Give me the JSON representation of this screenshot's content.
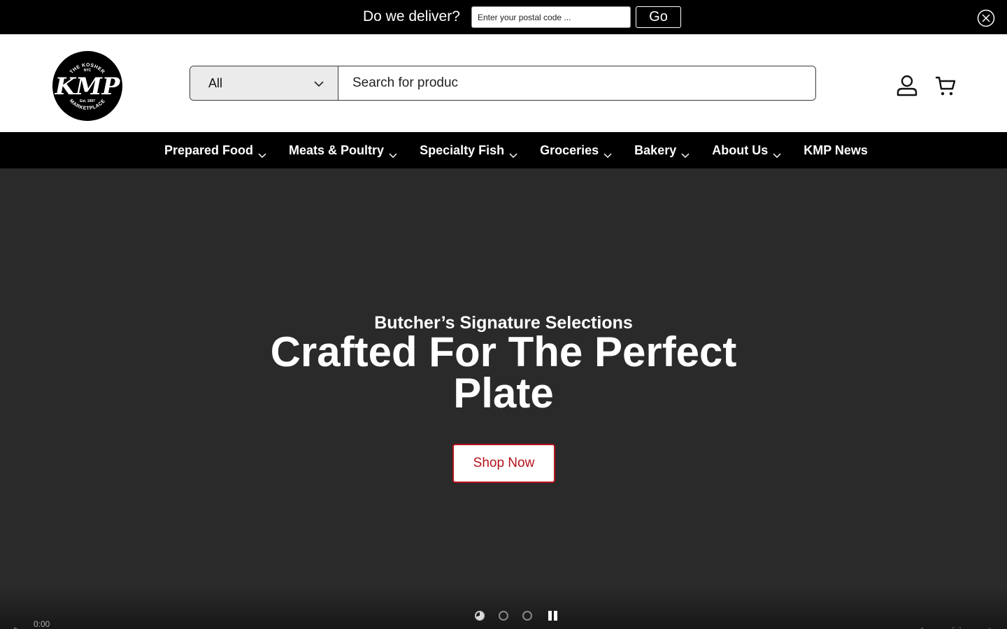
{
  "delivery": {
    "question": "Do we deliver?",
    "postal_placeholder": "Enter your postal code ...",
    "go_label": "Go",
    "close_icon": "close-circle-icon"
  },
  "header": {
    "logo": {
      "top_text": "THE KOSHER",
      "city": "NYC",
      "mark": "KMP",
      "established": "Est. 1997",
      "bottom_text": "MARKETPLACE"
    },
    "search": {
      "category": "All",
      "placeholder": "Search for produc"
    },
    "account_icon": "user-icon",
    "cart_icon": "cart-icon"
  },
  "nav": {
    "items": [
      {
        "label": "Prepared Food",
        "has_dropdown": true
      },
      {
        "label": "Meats & Poultry",
        "has_dropdown": true
      },
      {
        "label": "Specialty Fish",
        "has_dropdown": true
      },
      {
        "label": "Groceries",
        "has_dropdown": true
      },
      {
        "label": "Bakery",
        "has_dropdown": true
      },
      {
        "label": "About Us",
        "has_dropdown": true
      },
      {
        "label": "KMP News",
        "has_dropdown": false
      }
    ]
  },
  "hero": {
    "subtitle": "Butcher’s Signature Selections",
    "title": "Crafted For The Perfect Plate",
    "cta_label": "Shop Now",
    "slides": {
      "count": 3,
      "active": 1
    },
    "video_time": "0:00"
  },
  "colors": {
    "bar_black": "#000000",
    "hero_bg": "#2a2a2a",
    "cta_red": "#b5121b"
  }
}
